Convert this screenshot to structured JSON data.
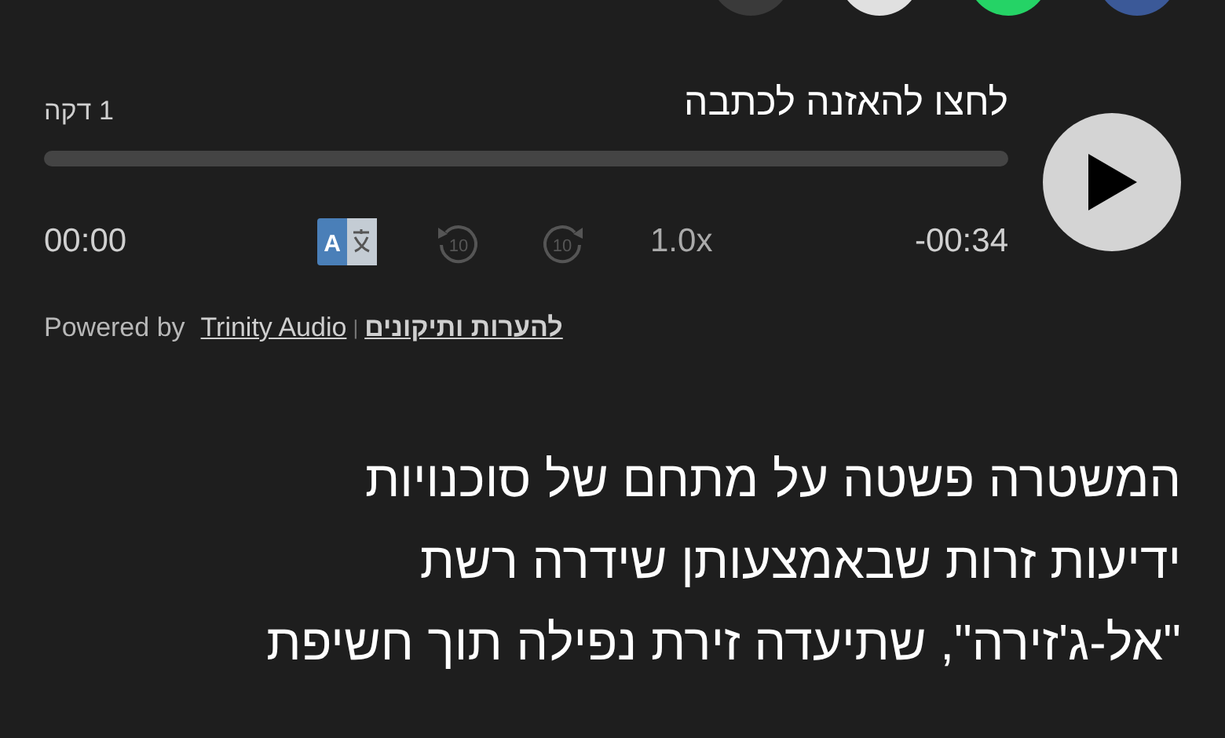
{
  "share_buttons": [
    {
      "kind": "copy"
    },
    {
      "kind": "email"
    },
    {
      "kind": "whatsapp"
    },
    {
      "kind": "facebook"
    }
  ],
  "player": {
    "title": "לחצו להאזנה לכתבה",
    "duration": "1 דקה",
    "progress": {
      "level": 0
    },
    "elapsed": "00:00",
    "remaining": "-00:34",
    "speed": "1.0x",
    "translate_label": "A",
    "rewind_label": "10",
    "forward_label": "10",
    "powered_by": "Powered by",
    "brand_link": "Trinity Audio",
    "separator": "|",
    "feedback_link": "להערות ותיקונים"
  },
  "article": {
    "text": "המשטרה פשטה על מתחם של סוכנויות\nידיעות זרות שבאמצעותן שידרה רשת\n\"אל-ג'זירה\", שתיעדה זירת נפילה תוך חשיפת"
  }
}
